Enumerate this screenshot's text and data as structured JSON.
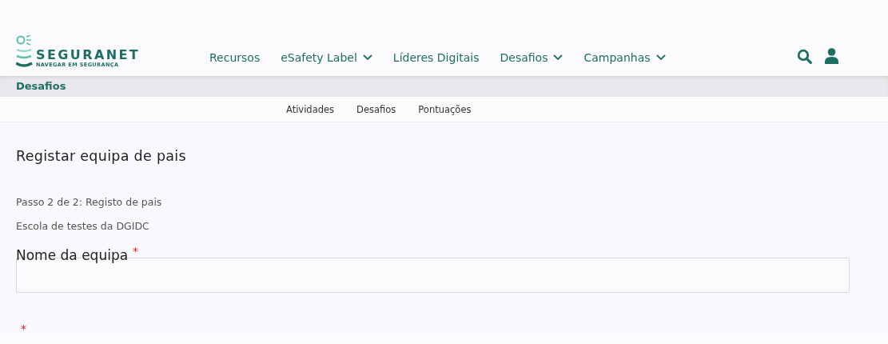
{
  "logo": {
    "name": "SEGURANET",
    "tagline": "NAVEGAR EM SEGURANÇA"
  },
  "nav": [
    {
      "label": "Recursos",
      "kind": "link"
    },
    {
      "label": "eSafety Label",
      "kind": "dropdown"
    },
    {
      "label": "Líderes Digitais",
      "kind": "link"
    },
    {
      "label": "Desafios",
      "kind": "dropdown"
    },
    {
      "label": "Campanhas",
      "kind": "dropdown"
    }
  ],
  "section_bar": {
    "title": "Desafios"
  },
  "subnav": [
    "Atividades",
    "Desafios",
    "Pontuações"
  ],
  "form": {
    "title": "Registar equipa de pais",
    "step": "Passo 2 de 2: Registo de pais",
    "school": "Escola de testes da DGIDC",
    "fields": [
      {
        "label": "Nome da equipa",
        "required_mark": "*"
      },
      {
        "required_mark": "*"
      }
    ]
  }
}
